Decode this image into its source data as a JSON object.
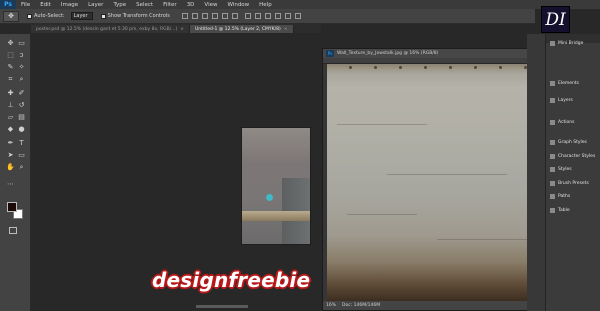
{
  "menubar": {
    "app_icon": "Ps",
    "items": [
      "File",
      "Edit",
      "Image",
      "Layer",
      "Type",
      "Select",
      "Filter",
      "3D",
      "View",
      "Window",
      "Help"
    ]
  },
  "options": {
    "tool_glyph": "✥",
    "auto_select_label": "Auto-Select:",
    "auto_select_value": "Layer",
    "show_transform_label": "Show Transform Controls"
  },
  "tabs": [
    {
      "label": "poster.psd @ 12.5% (dessin gant et 5.30 pm, exby 8x, RGB/...)",
      "active": false
    },
    {
      "label": "Untitled-1 @ 12.5% (Layer 2, CMYK/8)",
      "active": true
    }
  ],
  "big_doc": {
    "title": "Wall_Texture_by_Jowstalk.jpg @ 16% (RGB/8)",
    "zoom": "16%",
    "doc_info": "Doc: 146M/146M"
  },
  "panels": {
    "items": [
      "Mini Bridge",
      "Elements",
      "Layers",
      "Actions",
      "Graph Styles",
      "Character Styles",
      "Styles",
      "Brush Presets",
      "Paths",
      "Table"
    ]
  },
  "tools": [
    "move",
    "marquee",
    "lasso",
    "quick-select",
    "crop",
    "eyedropper",
    "healing",
    "brush",
    "stamp",
    "history-brush",
    "eraser",
    "gradient",
    "blur",
    "dodge",
    "pen",
    "type",
    "path-select",
    "shape",
    "hand",
    "zoom"
  ],
  "colors": {
    "foreground": "#1a0b08",
    "background": "#ffffff"
  },
  "logo": "DI",
  "watermark": "designfreebie"
}
